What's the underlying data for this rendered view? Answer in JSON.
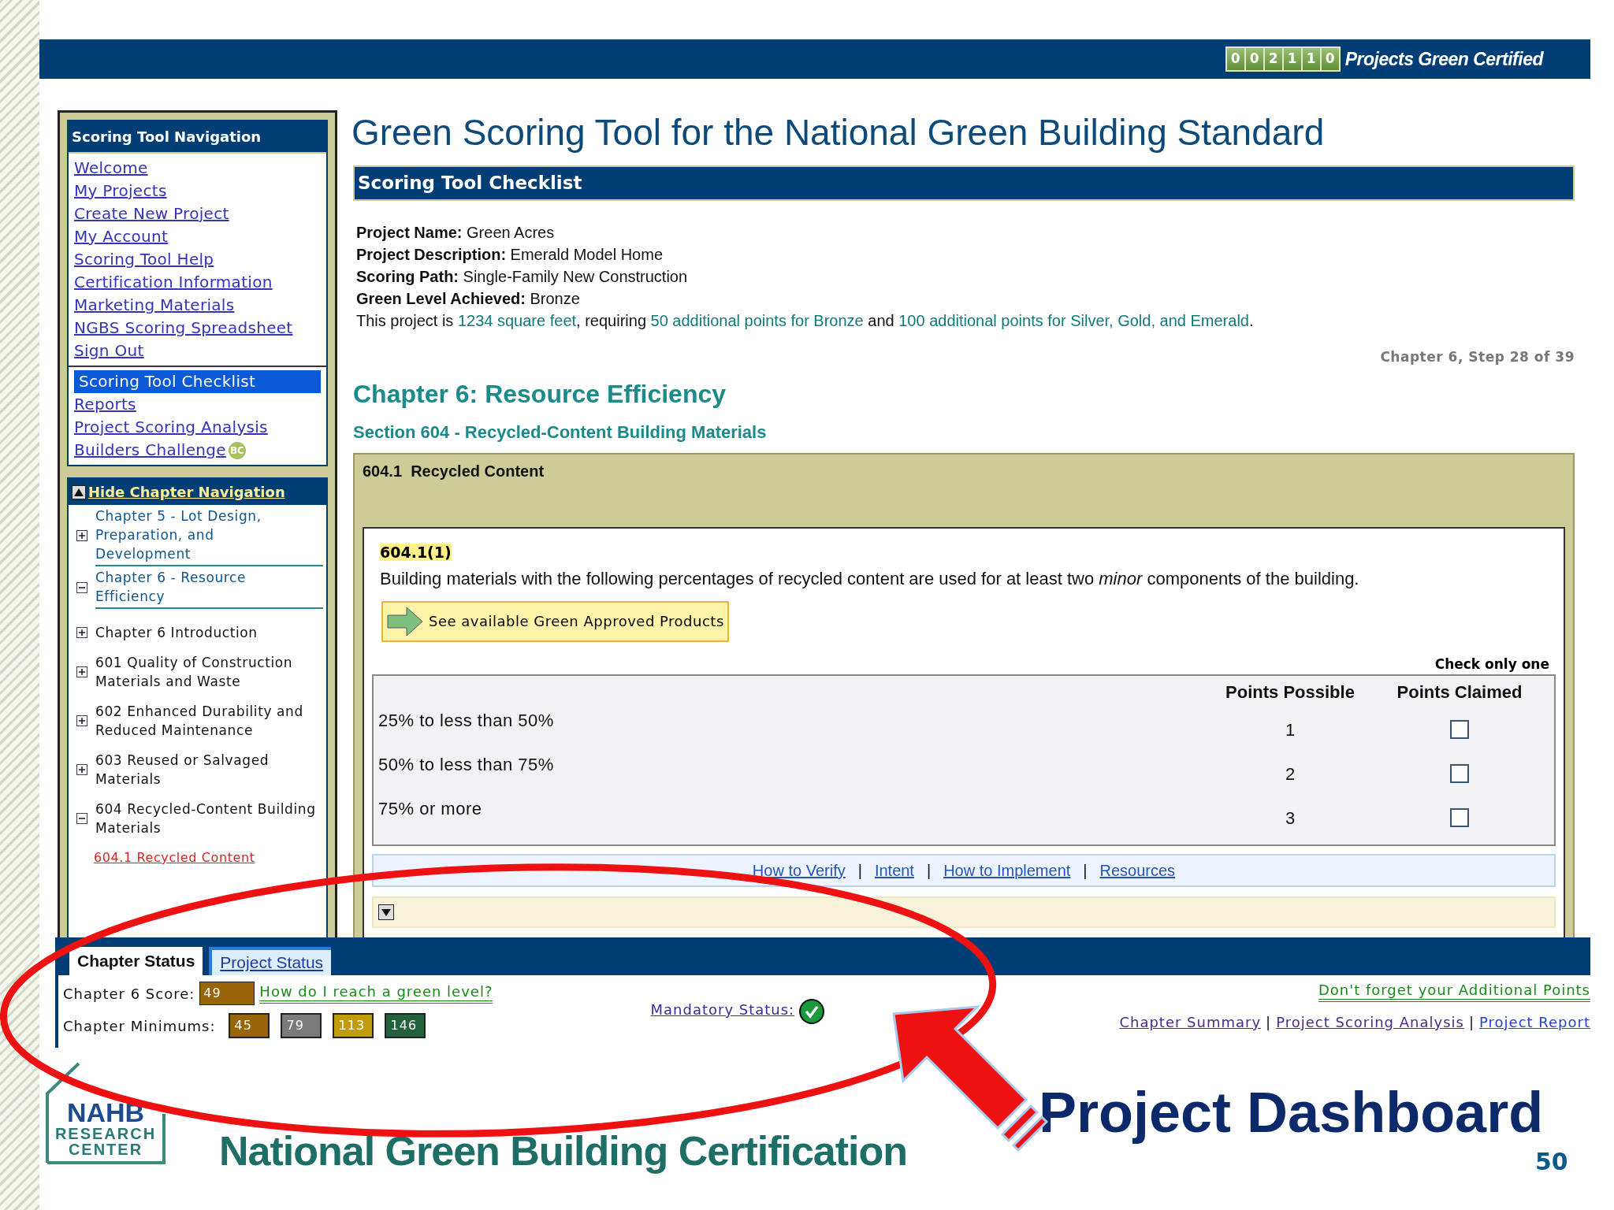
{
  "header": {
    "counter_digits": [
      "0",
      "0",
      "2",
      "1",
      "1",
      "0"
    ],
    "counter_label": "Projects Green Certified"
  },
  "sidebar": {
    "title": "Scoring Tool Navigation",
    "groups": [
      [
        {
          "label": "Welcome",
          "selected": false
        },
        {
          "label": "My Projects",
          "selected": false
        },
        {
          "label": "Create New Project",
          "selected": false
        },
        {
          "label": "My Account",
          "selected": false
        },
        {
          "label": "Scoring Tool Help",
          "selected": false
        },
        {
          "label": "Certification Information",
          "selected": false
        },
        {
          "label": "Marketing Materials",
          "selected": false
        },
        {
          "label": "NGBS Scoring Spreadsheet",
          "selected": false
        },
        {
          "label": "Sign Out",
          "selected": false
        }
      ],
      [
        {
          "label": "Scoring Tool Checklist",
          "selected": true
        },
        {
          "label": "Reports",
          "selected": false
        },
        {
          "label": "Project Scoring Analysis",
          "selected": false
        },
        {
          "label": "Builders Challenge",
          "selected": false,
          "badge": "BC"
        }
      ]
    ]
  },
  "chapter_nav": {
    "toggle": "Hide Chapter Navigation",
    "chapters": [
      {
        "label": "Chapter 5 - Lot Design, Preparation, and Development",
        "expanded": false
      },
      {
        "label": "Chapter 6 - Resource Efficiency",
        "expanded": true,
        "children": [
          {
            "label": "Chapter 6 Introduction",
            "expanded": false
          },
          {
            "label": "601 Quality of Construction Materials and Waste",
            "expanded": false
          },
          {
            "label": "602 Enhanced Durability and Reduced Maintenance",
            "expanded": false
          },
          {
            "label": "603 Reused or Salvaged Materials",
            "expanded": false
          },
          {
            "label": "604 Recycled-Content Building Materials",
            "expanded": true,
            "children": [
              {
                "label": "604.1 Recycled Content",
                "selected": true
              }
            ]
          }
        ]
      }
    ]
  },
  "main": {
    "title": "Green Scoring Tool for the National Green Building Standard",
    "section_bar": "Scoring Tool Checklist",
    "project_info": [
      {
        "label": "Project Name:",
        "value": "Green Acres"
      },
      {
        "label": "Project Description:",
        "value": "Emerald Model Home"
      },
      {
        "label": "Scoring Path:",
        "value": "Single-Family New Construction"
      },
      {
        "label": "Green Level Achieved:",
        "value": "Bronze"
      }
    ],
    "requirement_note": [
      {
        "text": "This project is ",
        "kind": "plain"
      },
      {
        "text": "1234 square feet",
        "kind": "highlight"
      },
      {
        "text": ", requiring ",
        "kind": "plain"
      },
      {
        "text": "50 additional points for Bronze",
        "kind": "highlight"
      },
      {
        "text": " and ",
        "kind": "plain"
      },
      {
        "text": "100 additional points for Silver, Gold, and Emerald",
        "kind": "highlight"
      },
      {
        "text": ".",
        "kind": "plain"
      }
    ],
    "step": "Chapter 6, Step 28 of 39",
    "chapter_heading": "Chapter 6: Resource Efficiency",
    "section_heading": "Section 604 - Recycled-Content Building Materials",
    "practice": {
      "heading": "604.1  Recycled Content",
      "code": "604.1(1)",
      "description": "Building materials with the following percentages of recycled content are used for at least two *minor* components of the building.",
      "products_button": "See available Green Approved Products",
      "table": {
        "note": "Check only one",
        "columns": [
          "Points Possible",
          "Points Claimed"
        ],
        "rows": [
          {
            "label": "25% to less than 50%",
            "points": "1",
            "checked": false
          },
          {
            "label": "50% to less than 75%",
            "points": "2",
            "checked": false
          },
          {
            "label": "75% or more",
            "points": "3",
            "checked": false
          }
        ]
      },
      "links": [
        "How to Verify",
        "Intent",
        "How to Implement",
        "Resources"
      ],
      "link_separator": "|"
    }
  },
  "dashboard": {
    "tabs": [
      {
        "label": "Chapter Status",
        "selected": true
      },
      {
        "label": "Project Status",
        "selected": false
      }
    ],
    "score_label": "Chapter 6 Score:",
    "score": {
      "value": "49",
      "color": "#9a6408"
    },
    "help_link": "How do I reach a green level?",
    "minimums_label": "Chapter Minimums:",
    "minimums": [
      {
        "value": "45",
        "color": "#9a6408"
      },
      {
        "value": "79",
        "color": "#7a7a7a"
      },
      {
        "value": "113",
        "color": "#c09c08"
      },
      {
        "value": "146",
        "color": "#22603e"
      }
    ],
    "mandatory_label": "Mandatory Status:",
    "mandatory_ok": true,
    "additional_link": "Don't forget your Additional Points",
    "bottom_links": [
      "Chapter Summary",
      "Project Scoring Analysis",
      "Project Report"
    ],
    "link_separator": "|"
  },
  "slide": {
    "logo_lines": [
      "NAHB",
      "RESEARCH",
      "CENTER"
    ],
    "footer_title": "National Green Building Certification",
    "caption": "Project Dashboard",
    "page": "50"
  }
}
